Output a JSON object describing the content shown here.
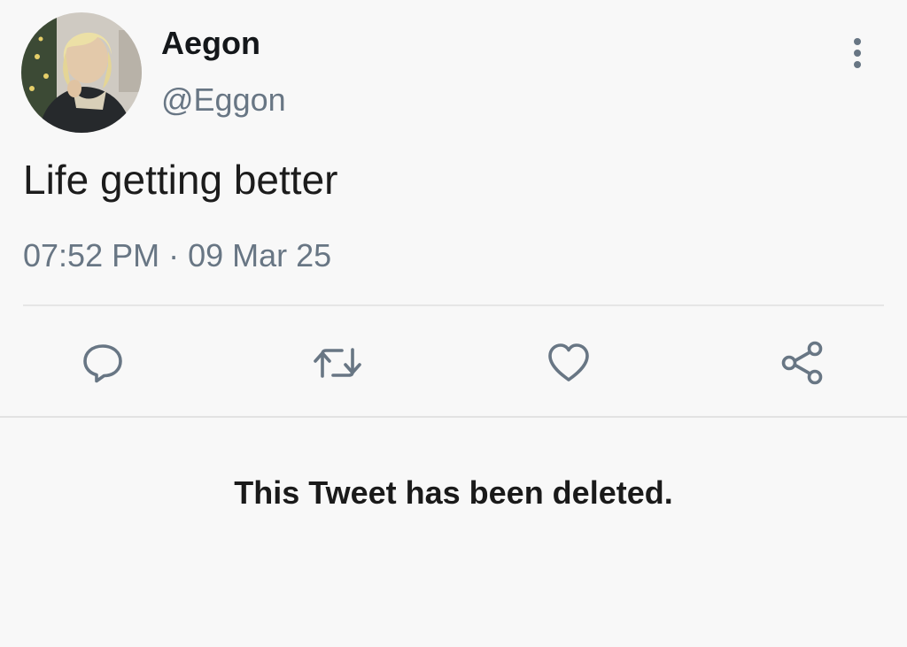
{
  "tweet": {
    "author": {
      "display_name": "Aegon",
      "handle": "@Eggon",
      "avatar_icon": "user-photo-avatar"
    },
    "text": "Life getting better",
    "time": "07:52 PM",
    "separator": "·",
    "date": "09 Mar 25",
    "actions": {
      "reply_icon": "speech-bubble-icon",
      "retweet_icon": "retweet-arrows-icon",
      "like_icon": "heart-icon",
      "share_icon": "share-nodes-icon"
    },
    "more_icon": "vertical-ellipsis-icon"
  },
  "quoted": {
    "notice": "This Tweet has been deleted."
  },
  "colors": {
    "background": "#f8f8f8",
    "primary_text": "#14171a",
    "secondary_text": "#687684",
    "icon": "#687684",
    "divider": "#e6e6e6"
  }
}
